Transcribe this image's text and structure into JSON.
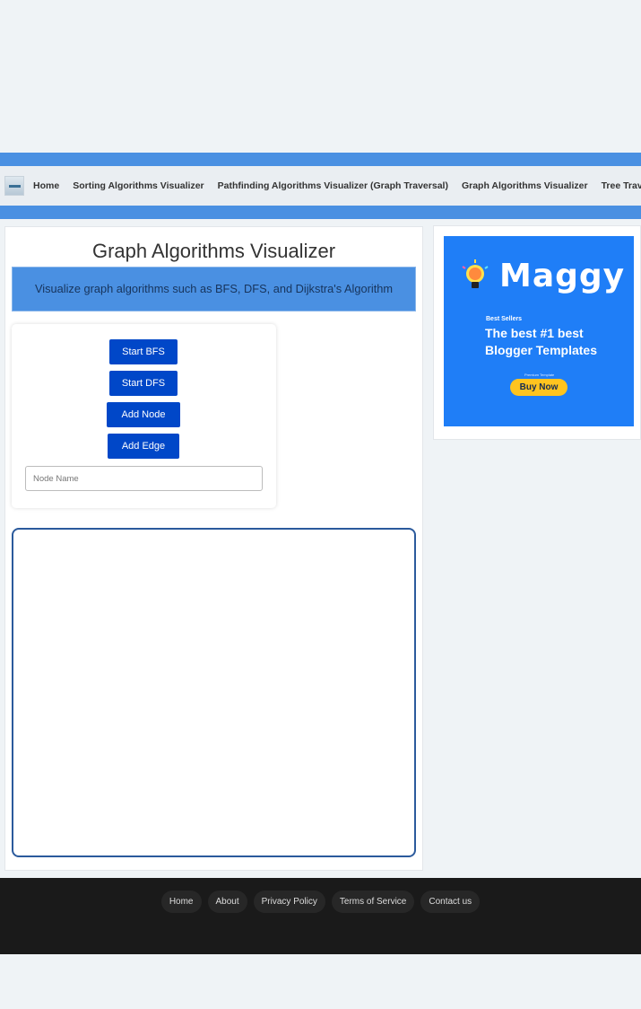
{
  "nav": {
    "items": [
      {
        "label": "Home"
      },
      {
        "label": "Sorting Algorithms Visualizer"
      },
      {
        "label": "Pathfinding Algorithms Visualizer (Graph Traversal)"
      },
      {
        "label": "Graph Algorithms Visualizer"
      },
      {
        "label": "Tree Traversal And"
      }
    ]
  },
  "main": {
    "title": "Graph Algorithms Visualizer",
    "subtitle": "Visualize graph algorithms such as BFS, DFS, and Dijkstra's Algorithm",
    "controls": {
      "start_bfs": "Start BFS",
      "start_dfs": "Start DFS",
      "add_node": "Add Node",
      "add_edge": "Add Edge",
      "node_placeholder": "Node Name"
    }
  },
  "ad": {
    "brand": "Maggy",
    "tagline": "Best Sellers",
    "headline": "The best #1 best Blogger Templates",
    "small_text": "Premium Template",
    "cta": "Buy Now"
  },
  "footer": {
    "links": [
      {
        "label": "Home"
      },
      {
        "label": "About"
      },
      {
        "label": "Privacy Policy"
      },
      {
        "label": "Terms of Service"
      },
      {
        "label": "Contact us"
      }
    ]
  },
  "colors": {
    "accent": "#4a90e2",
    "button": "#0047c8",
    "footer": "#1a1a1a"
  }
}
